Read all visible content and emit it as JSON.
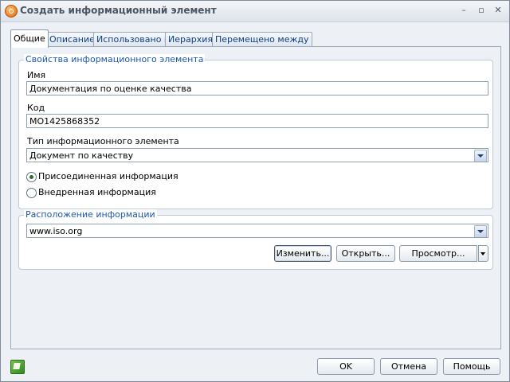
{
  "window": {
    "title": "Создать информационный элемент",
    "controls": [
      "–",
      "▫",
      "✕"
    ]
  },
  "tabs": [
    {
      "label": "Общие",
      "active": true
    },
    {
      "label": "Описание",
      "active": false
    },
    {
      "label": "Использовано в",
      "active": false
    },
    {
      "label": "Иерархия",
      "active": false
    },
    {
      "label": "Перемещено между",
      "active": false
    }
  ],
  "properties": {
    "legend": "Свойства информационного элемента",
    "name_label": "Имя",
    "name_value": "Документация по оценке качества",
    "code_label": "Код",
    "code_value": "MO1425868352",
    "type_label": "Тип информационного элемента",
    "type_value": "Документ по качеству",
    "radio_attached": "Присоединенная информация",
    "radio_embedded": "Внедренная информация",
    "selected_radio": "attached"
  },
  "location": {
    "legend": "Расположение информации",
    "value": "www.iso.org",
    "btn_change": "Изменить...",
    "btn_open": "Открыть...",
    "btn_view": "Просмотр..."
  },
  "footer": {
    "ok": "OK",
    "cancel": "Отмена",
    "help": "Помощь"
  },
  "icons": {
    "app": "app-logo-icon",
    "help": "green-book-icon"
  }
}
